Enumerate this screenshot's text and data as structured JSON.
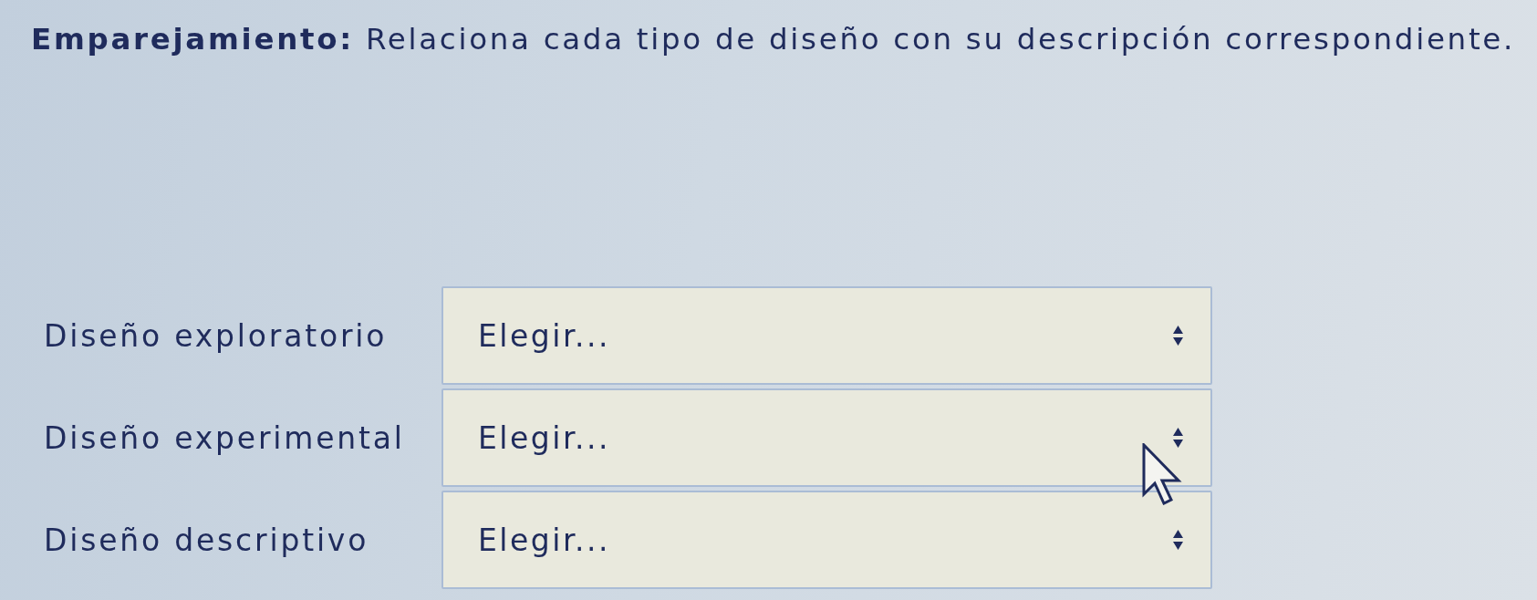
{
  "instruction": "**Emparejamiento:** Relaciona cada tipo de diseño con su descripción correspondiente.",
  "rows": [
    {
      "term": "Diseño exploratorio",
      "select": {
        "value": "Elegir..."
      }
    },
    {
      "term": "Diseño experimental",
      "select": {
        "value": "Elegir..."
      }
    },
    {
      "term": "Diseño descriptivo",
      "select": {
        "value": "Elegir..."
      }
    }
  ]
}
